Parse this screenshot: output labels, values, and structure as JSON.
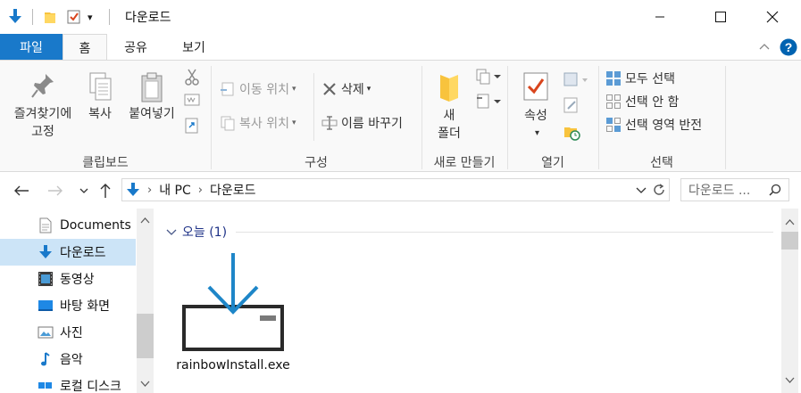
{
  "titlebar": {
    "title": "다운로드",
    "qa_dropdown": "▾",
    "controls": {
      "minimize": "—",
      "maximize": "☐",
      "close": "✕"
    }
  },
  "tabs": [
    {
      "label": "파일"
    },
    {
      "label": "홈"
    },
    {
      "label": "공유"
    },
    {
      "label": "보기"
    }
  ],
  "ribbon": {
    "clipboard": {
      "pin": "즐겨찾기에\n고정",
      "copy": "복사",
      "paste": "붙여넣기",
      "label": "클립보드"
    },
    "organize": {
      "move_to": "이동 위치",
      "copy_to": "복사 위치",
      "delete": "삭제",
      "rename": "이름 바꾸기",
      "label": "구성"
    },
    "new": {
      "new_folder": "새\n폴더",
      "label": "새로 만들기"
    },
    "open": {
      "properties": "속성",
      "label": "열기"
    },
    "select": {
      "select_all": "모두 선택",
      "select_none": "선택 안 함",
      "invert": "선택 영역 반전",
      "label": "선택"
    }
  },
  "address": {
    "crumbs": [
      "내 PC",
      "다운로드"
    ],
    "sep": "›",
    "search_placeholder": "다운로드 ..."
  },
  "navpane": {
    "items": [
      {
        "label": "Documents",
        "icon": "document-icon"
      },
      {
        "label": "다운로드",
        "icon": "download-icon",
        "selected": true
      },
      {
        "label": "동영상",
        "icon": "film-icon"
      },
      {
        "label": "바탕 화면",
        "icon": "desktop-icon"
      },
      {
        "label": "사진",
        "icon": "picture-icon"
      },
      {
        "label": "음악",
        "icon": "music-icon"
      },
      {
        "label": "로컬 디스크",
        "icon": "drive-icon"
      }
    ]
  },
  "content": {
    "group_header": "오늘 (1)",
    "files": [
      {
        "name": "rainbowInstall.exe",
        "icon": "installer-icon"
      }
    ]
  },
  "colors": {
    "accent": "#1979ca",
    "selection": "#cce4f7",
    "group_header": "#1e3287",
    "help": "#0063b1"
  }
}
